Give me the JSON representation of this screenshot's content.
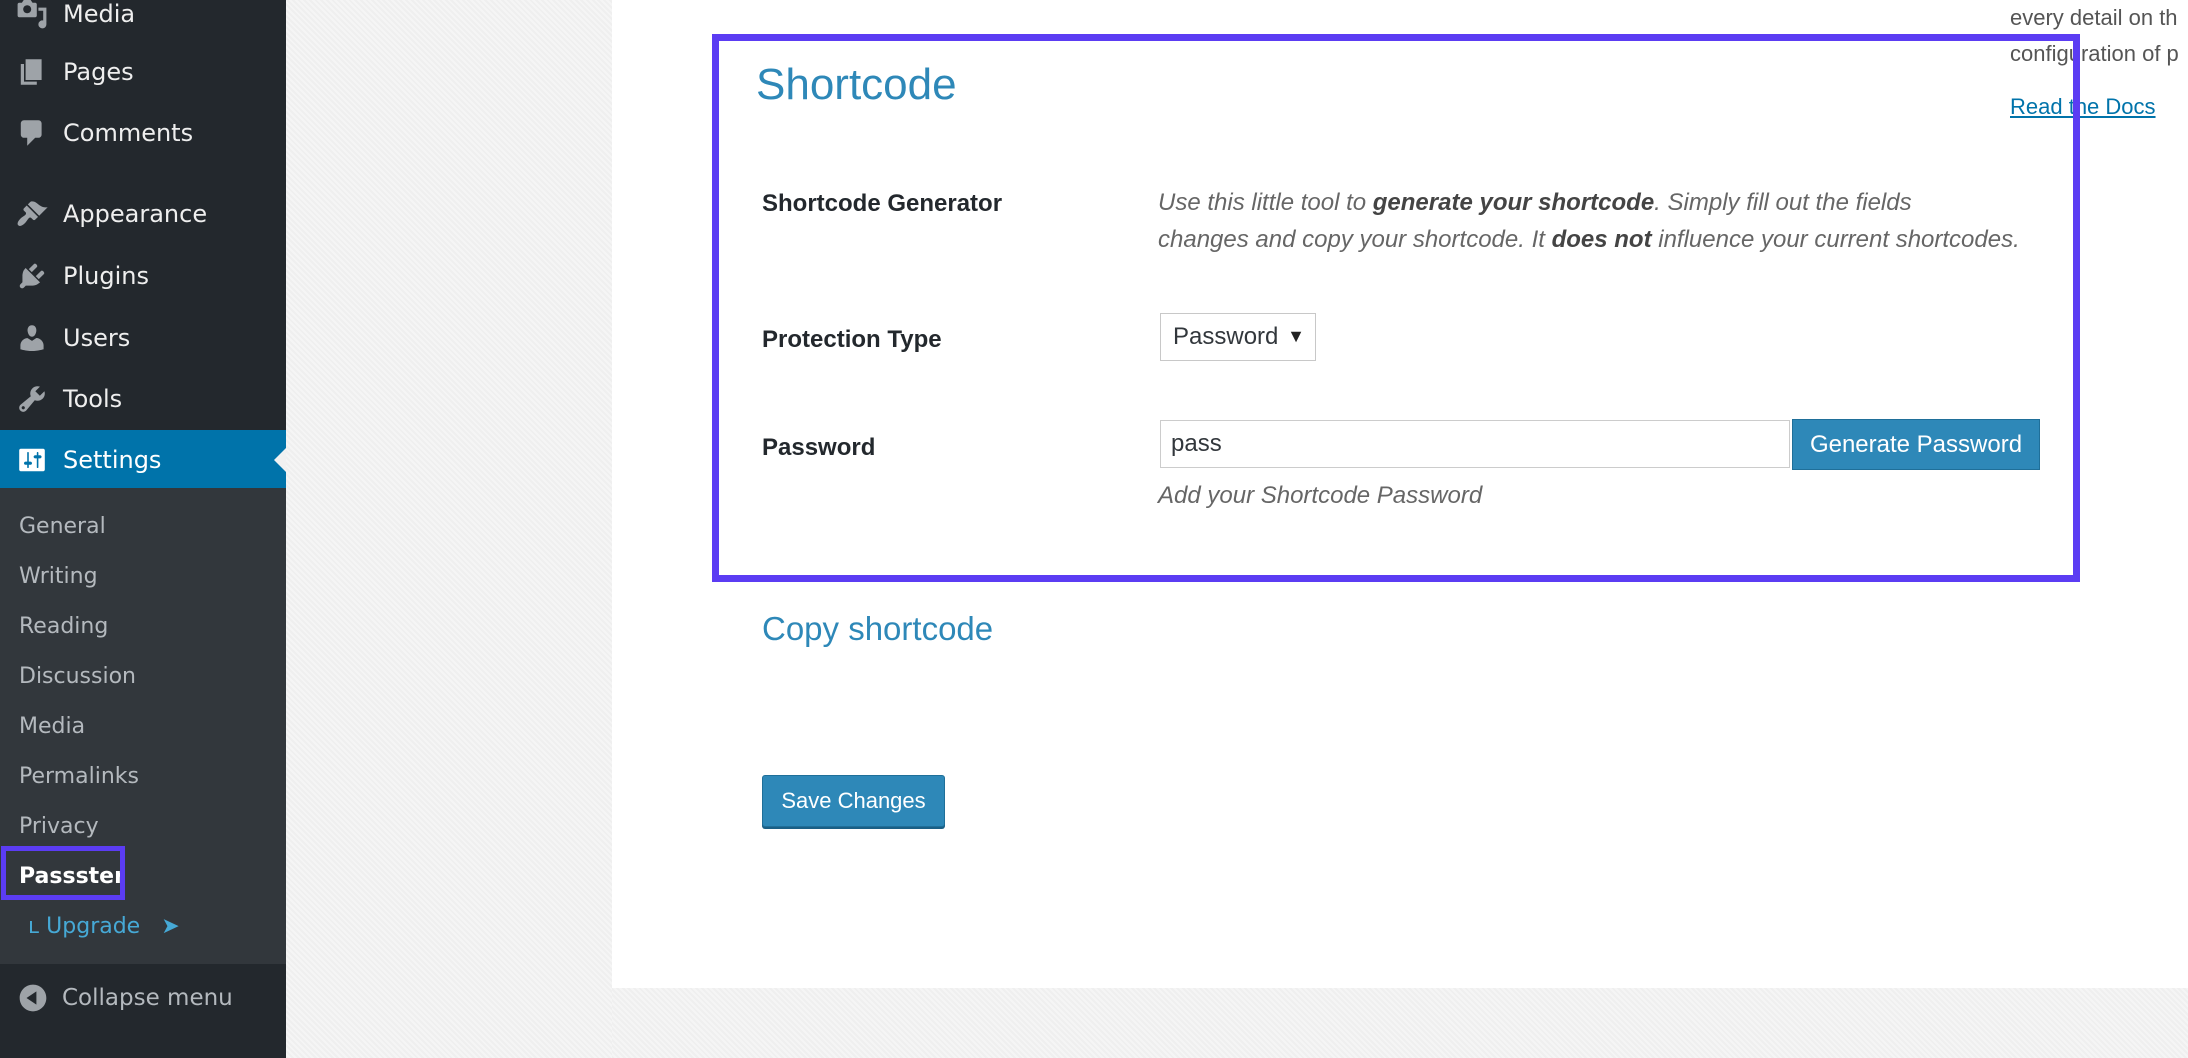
{
  "sidebar": {
    "items": [
      {
        "label": "Media",
        "icon": "media-icon"
      },
      {
        "label": "Pages",
        "icon": "pages-icon"
      },
      {
        "label": "Comments",
        "icon": "comments-icon"
      },
      {
        "label": "Appearance",
        "icon": "appearance-icon"
      },
      {
        "label": "Plugins",
        "icon": "plugins-icon"
      },
      {
        "label": "Users",
        "icon": "users-icon"
      },
      {
        "label": "Tools",
        "icon": "tools-icon"
      },
      {
        "label": "Settings",
        "icon": "settings-icon"
      }
    ],
    "submenu": [
      "General",
      "Writing",
      "Reading",
      "Discussion",
      "Media",
      "Permalinks",
      "Privacy",
      "Passster"
    ],
    "upgrade_label": "Upgrade",
    "collapse_label": "Collapse menu"
  },
  "aside": {
    "line1": "every detail on th",
    "line2": "configuration of p",
    "docs_link": "Read the Docs"
  },
  "section": {
    "title": "Shortcode",
    "generator_label": "Shortcode Generator",
    "desc_1": "Use this little tool to ",
    "desc_bold_1": "generate your shortcode",
    "desc_2": ". Simply fill out the fields",
    "desc_3": "changes and copy your shortcode. It ",
    "desc_bold_2": "does not",
    "desc_4": " influence your current shortcodes.",
    "protection_label": "Protection Type",
    "protection_value": "Password",
    "password_label": "Password",
    "password_value": "pass",
    "generate_button": "Generate Password",
    "password_hint": "Add your Shortcode Password",
    "copy_title": "Copy shortcode",
    "save_button": "Save Changes"
  },
  "colors": {
    "accent": "#0073aa",
    "heading": "#2e88b8",
    "highlight": "#5b3cf3",
    "sidebar_bg": "#23282d"
  }
}
